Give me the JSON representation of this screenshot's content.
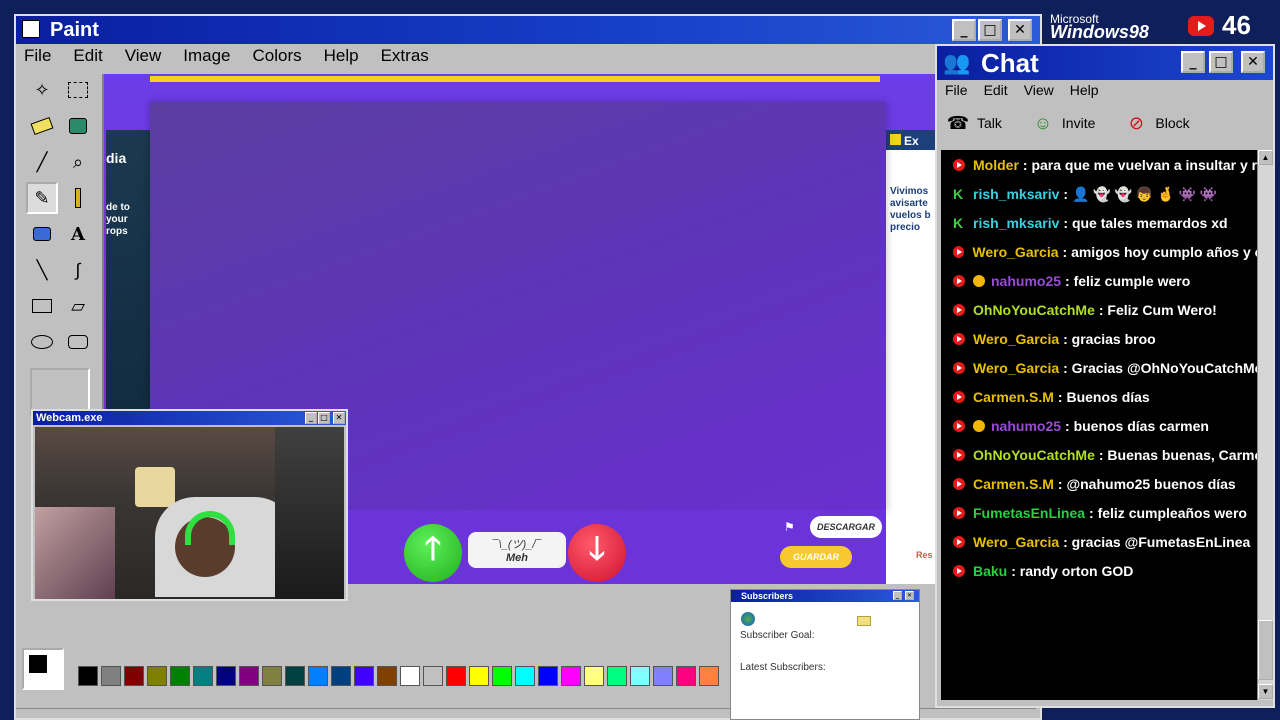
{
  "paint": {
    "title": "Paint",
    "menu": [
      "File",
      "Edit",
      "View",
      "Image",
      "Colors",
      "Help",
      "Extras"
    ],
    "tools": [
      "free-select",
      "rect-select",
      "eraser",
      "fill",
      "color-picker",
      "magnifier",
      "pencil",
      "brush",
      "airbrush",
      "text",
      "line",
      "curve",
      "rectangle",
      "polygon",
      "ellipse",
      "rounded-rect"
    ],
    "palette": [
      "#000000",
      "#808080",
      "#800000",
      "#808000",
      "#008000",
      "#008080",
      "#000080",
      "#800080",
      "#808040",
      "#004040",
      "#0080ff",
      "#004080",
      "#4000ff",
      "#804000",
      "#ffffff",
      "#c0c0c0",
      "#ff0000",
      "#ffff00",
      "#00ff00",
      "#00ffff",
      "#0000ff",
      "#ff00ff",
      "#ffff80",
      "#00ff80",
      "#80ffff",
      "#8080ff",
      "#ff0080",
      "#ff8040"
    ]
  },
  "canvas_screenshot": {
    "left_text_1": "dia",
    "left_text_2": "de to\nyour\nrops",
    "right_text_1": "Ex",
    "right_text_2": "Vivimos\navisarte\nvuelos b\nprecio",
    "right_text_3": "Res",
    "meh_face": "¯\\_(ツ)_/¯",
    "meh_label": "Meh",
    "descargar_label": "DESCARGAR",
    "guardar_label": "GUARDAR"
  },
  "webcam": {
    "title": "Webcam.exe"
  },
  "top_right": {
    "windows_brand_1": "Microsoft",
    "windows_brand_2": "Windows98",
    "yt_count": "46"
  },
  "chat": {
    "title": "Chat",
    "menu": [
      "File",
      "Edit",
      "View",
      "Help"
    ],
    "tools": [
      {
        "label": "Talk"
      },
      {
        "label": "Invite"
      },
      {
        "label": "Block"
      }
    ],
    "messages": [
      {
        "badge": "yt",
        "user": "Molder",
        "color": "#e8c000",
        "text": ": para que me vuelvan a insultar y ro"
      },
      {
        "badge": "kick",
        "user": "rish_mksariv",
        "color": "#3ad0e0",
        "text": ":  👤 👻 👻 👦 🤞 👾 👾"
      },
      {
        "badge": "kick",
        "user": "rish_mksariv",
        "color": "#3ad0e0",
        "text": ": que tales memardos xd"
      },
      {
        "badge": "yt",
        "user": "Wero_Garcia",
        "color": "#e8c000",
        "text": ": amigos hoy cumplo años y co"
      },
      {
        "badge": "yt",
        "sub": true,
        "user": "nahumo25",
        "color": "#9a4ad8",
        "text": ": feliz cumple wero"
      },
      {
        "badge": "yt",
        "user": "OhNoYouCatchMe",
        "color": "#b0e020",
        "text": ": Feliz Cum Wero!"
      },
      {
        "badge": "yt",
        "user": "Wero_Garcia",
        "color": "#e8c000",
        "text": ": gracias broo"
      },
      {
        "badge": "yt",
        "user": "Wero_Garcia",
        "color": "#e8c000",
        "text": ": Gracias @OhNoYouCatchMe"
      },
      {
        "badge": "yt",
        "user": "Carmen.S.M",
        "color": "#e8c000",
        "text": ": Buenos días"
      },
      {
        "badge": "yt",
        "sub": true,
        "user": "nahumo25",
        "color": "#9a4ad8",
        "text": ": buenos días carmen"
      },
      {
        "badge": "yt",
        "user": "OhNoYouCatchMe",
        "color": "#b0e020",
        "text": ": Buenas buenas, Carmen"
      },
      {
        "badge": "yt",
        "user": "Carmen.S.M",
        "color": "#e8c000",
        "text": ": @nahumo25 buenos días"
      },
      {
        "badge": "yt",
        "user": "FumetasEnLinea",
        "color": "#2ad040",
        "text": ": feliz cumpleaños wero"
      },
      {
        "badge": "yt",
        "user": "Wero_Garcia",
        "color": "#e8c000",
        "text": ": gracias @FumetasEnLinea"
      },
      {
        "badge": "yt",
        "user": "Baku",
        "color": "#2ad040",
        "text": ": randy orton GOD"
      }
    ]
  },
  "subscribers": {
    "title": "Subscribers",
    "goal_label": "Subscriber Goal:",
    "latest_label": "Latest Subscribers:"
  },
  "colors": {
    "titlebar": "#0a1ea0",
    "window_face": "#c0c0c0",
    "chat_bg": "#000000"
  }
}
